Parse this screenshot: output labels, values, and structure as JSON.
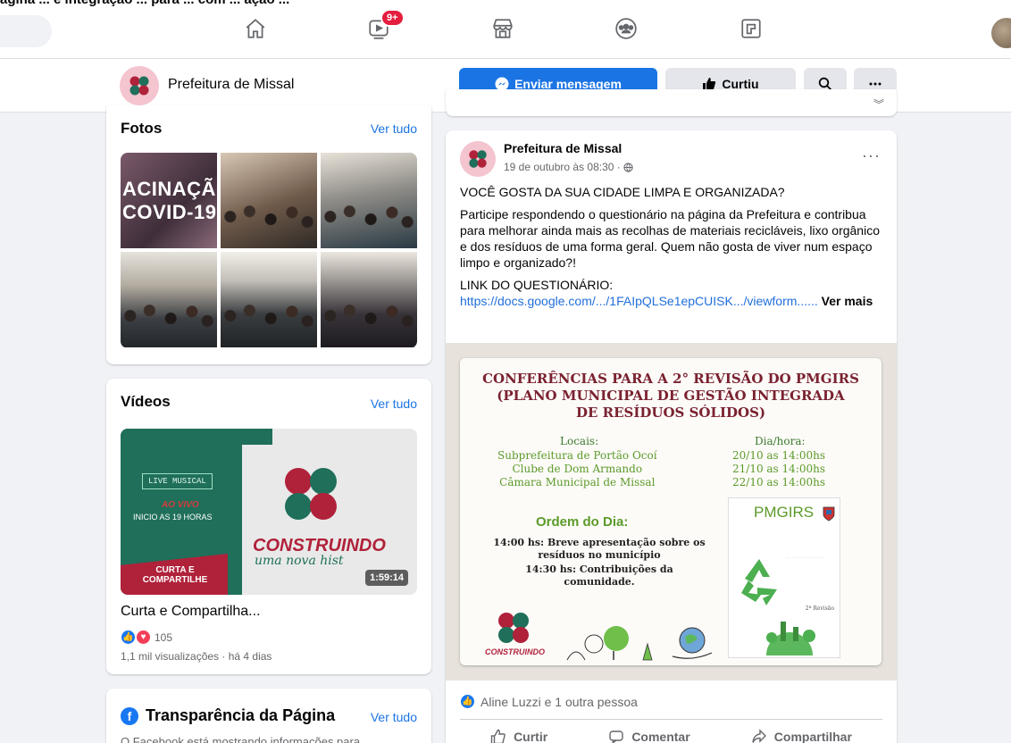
{
  "topnav": {
    "cut_text": "ágina ... e integração ... para ... com ... ação ...",
    "watch_badge": "9+",
    "icons": [
      "home-icon",
      "watch-icon",
      "marketplace-icon",
      "groups-icon",
      "gaming-icon"
    ]
  },
  "page_header": {
    "name": "Prefeitura de Missal",
    "send_message": "Enviar mensagem",
    "liked": "Curtiu"
  },
  "photos": {
    "title": "Fotos",
    "see_all": "Ver tudo",
    "photo1_text_line1": "ACINAÇÃ",
    "photo1_text_line2": "COVID-19"
  },
  "videos": {
    "title": "Vídeos",
    "see_all": "Ver tudo",
    "thumb": {
      "live": "LIVE MUSICAL",
      "ao_vivo": "AO VIVO",
      "inicio": "INICIO AS 19 HORAS",
      "curta_line1": "CURTA E",
      "curta_line2": "COMPARTILHE",
      "construindo": "CONSTRUINDO",
      "uma_nova": "uma nova hist",
      "duration": "1:59:14"
    },
    "video_title": "Curta e Compartilha...",
    "reaction_count": "105",
    "meta": "1,1 mil visualizações · há 4 dias"
  },
  "transparency": {
    "title": "Transparência da Página",
    "see_all": "Ver tudo",
    "text": "O Facebook está mostrando informações para"
  },
  "post": {
    "author": "Prefeitura de Missal",
    "time": "19 de outubro às 08:30 ·",
    "line1": "VOCÊ GOSTA DA SUA CIDADE LIMPA E ORGANIZADA?",
    "para1": "Participe respondendo o questionário na página da Prefeitura e contribua para melhorar ainda mais as recolhas de materiais recicláveis, lixo orgânico e dos resíduos de uma forma geral. Quem não gosta de viver num espaço limpo e organizado?!",
    "link_label": "LINK DO QUESTIONÁRIO:",
    "link": "https://docs.google.com/.../1FAIpQLSe1epCUISK.../viewform......",
    "see_more": "Ver mais",
    "poster": {
      "title_line1": "CONFERÊNCIAS PARA A 2° REVISÃO DO PMGIRS",
      "title_line2": "(PLANO MUNICIPAL DE GESTÃO INTEGRADA",
      "title_line3": "DE RESÍDUOS SÓLIDOS)",
      "locais": "Locais:",
      "dia_hora": "Dia/hora:",
      "loc1": "Subprefeitura de Portão Ocoí",
      "loc2": "Clube de Dom Armando",
      "loc3": "Câmara Municipal de Missal",
      "date1": "20/10 as 14:00hs",
      "date2": "21/10 as 14:00hs",
      "date3": "22/10 as 14:00hs",
      "ordem": "Ordem do Dia:",
      "item1_line1": "14:00 hs: Breve apresentação sobre os",
      "item1_line2": "resíduos no município",
      "item2_line1": "14:30 hs: Contribuições da",
      "item2_line2": "comunidade.",
      "pmgirs": "PMGIRS",
      "revisao": "2ª Revisão",
      "logo_text": "CONSTRUINDO"
    },
    "likes": "Aline Luzzi e 1 outra pessoa",
    "actions": {
      "like": "Curtir",
      "comment": "Comentar",
      "share": "Compartilhar"
    }
  },
  "colors": {
    "brand_blue": "#1b74e4",
    "badge_red": "#e41e3f",
    "poster_title": "#7a2230",
    "poster_green": "#5b9a2a"
  }
}
